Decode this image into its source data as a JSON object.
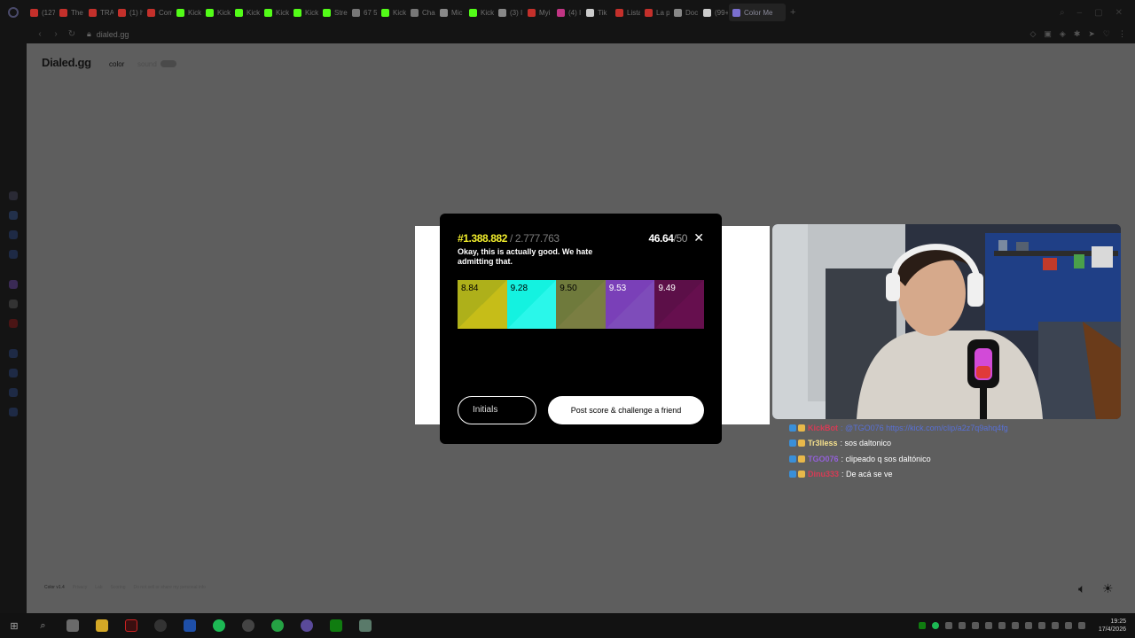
{
  "browser": {
    "tabs": [
      {
        "label": "(127",
        "color": "#c4302b"
      },
      {
        "label": "The",
        "color": "#c4302b"
      },
      {
        "label": "TRA",
        "color": "#c4302b"
      },
      {
        "label": "(1) h",
        "color": "#c4302b"
      },
      {
        "label": "Com",
        "color": "#c4302b"
      },
      {
        "label": "Kick",
        "color": "#53fc18"
      },
      {
        "label": "Kick",
        "color": "#53fc18"
      },
      {
        "label": "Kick",
        "color": "#53fc18"
      },
      {
        "label": "Kick",
        "color": "#53fc18"
      },
      {
        "label": "Kick",
        "color": "#53fc18"
      },
      {
        "label": "Stre",
        "color": "#53fc18"
      },
      {
        "label": "67 5",
        "color": "#777777"
      },
      {
        "label": "Kick",
        "color": "#53fc18"
      },
      {
        "label": "Cha",
        "color": "#777777"
      },
      {
        "label": "Mic",
        "color": "#888888"
      },
      {
        "label": "Kick",
        "color": "#53fc18"
      },
      {
        "label": "(3) I",
        "color": "#888888"
      },
      {
        "label": "Myi",
        "color": "#c4302b"
      },
      {
        "label": "(4) I",
        "color": "#c13584"
      },
      {
        "label": "Tik",
        "color": "#cccccc"
      },
      {
        "label": "Lista",
        "color": "#c4302b"
      },
      {
        "label": "La p",
        "color": "#c4302b"
      },
      {
        "label": "Doc",
        "color": "#888888"
      },
      {
        "label": "(99+",
        "color": "#cccccc"
      },
      {
        "label": "Color Me",
        "color": "#7a6fcf",
        "active": true
      }
    ],
    "new_tab": "+",
    "url": "dialed.gg"
  },
  "page": {
    "brand": "Dialed.gg",
    "mode_color": "color",
    "mode_sound": "sound",
    "footer_version": "Color v1.4",
    "footer_links": [
      "Privacy",
      "Lab",
      "Scoring",
      "Do not sell or share my personal info"
    ]
  },
  "result": {
    "rank": "#1.388.882",
    "rank_total": " / 2.777.763",
    "score": "46.64",
    "score_max": "/50",
    "message": "Okay, this is actually good. We hate admitting that.",
    "swatches": [
      {
        "score": "8.84",
        "target": "#aeb01a",
        "guess": "#c6bd18",
        "dark": false
      },
      {
        "score": "9.28",
        "target": "#14f2e0",
        "guess": "#2af7ea",
        "dark": false
      },
      {
        "score": "9.50",
        "target": "#6f7a3c",
        "guess": "#7a7e42",
        "dark": false
      },
      {
        "score": "9.53",
        "target": "#7a40b8",
        "guess": "#7e4cba",
        "dark": true
      },
      {
        "score": "9.49",
        "target": "#5c0f48",
        "guess": "#660f4e",
        "dark": true
      }
    ],
    "initials_button": "Initials",
    "post_button": "Post score & challenge a friend"
  },
  "chat": [
    {
      "user": "KickBot",
      "user_color": "#d63b55",
      "text": ": @TGO076 https://kick.com/clip/a2z7q9ahq4fg",
      "text_color": "#5870d6"
    },
    {
      "user": "Tr3lless",
      "user_color": "#f5e08c",
      "text": ": sos daltonico",
      "text_color": "#ffffff"
    },
    {
      "user": "TGO076",
      "user_color": "#9360d8",
      "text": ": clipeado q sos daltónico",
      "text_color": "#ffffff"
    },
    {
      "user": "Dinu333",
      "user_color": "#d63b55",
      "text": ": De acá se ve",
      "text_color": "#ffffff"
    }
  ],
  "taskbar": {
    "time": "19:25",
    "date": "17/4/2026"
  }
}
